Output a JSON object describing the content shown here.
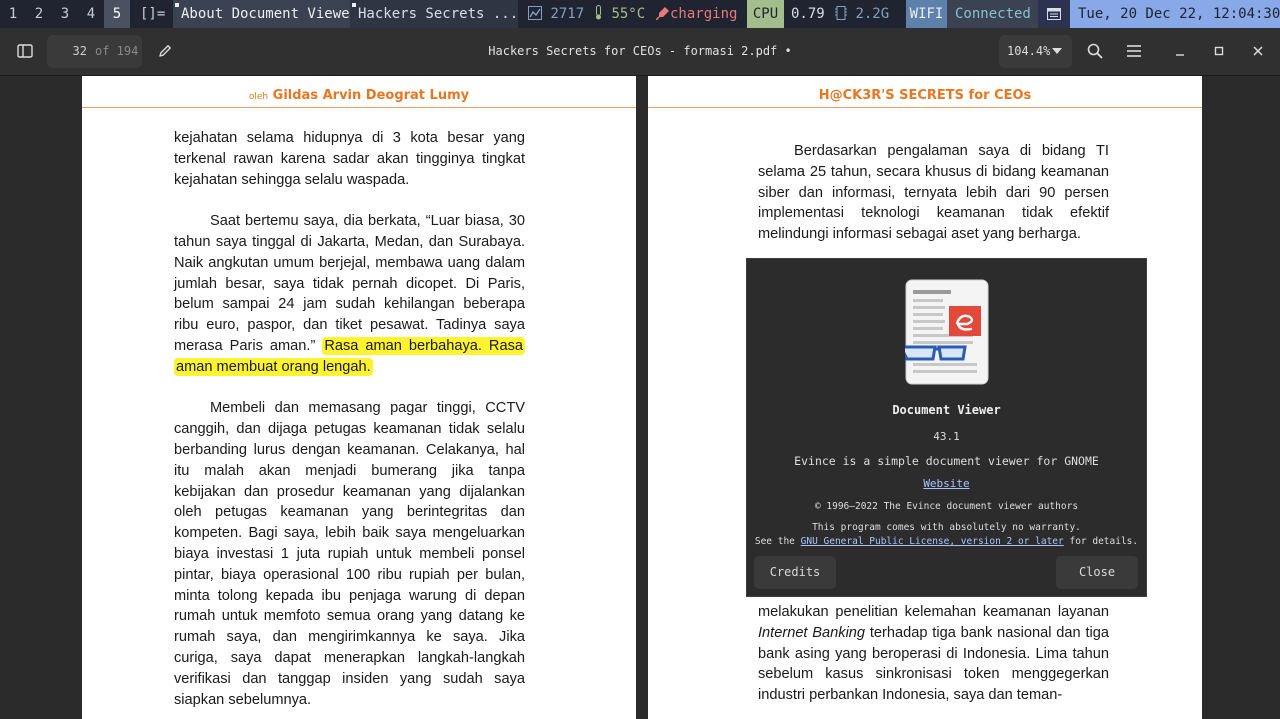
{
  "statusbar": {
    "workspaces": [
      "1",
      "2",
      "3",
      "4",
      "5"
    ],
    "active_workspace": "5",
    "layout": "[]=",
    "windows": [
      "About Document Viewer",
      "Hackers Secrets ..."
    ],
    "net": "2717",
    "temp": "55°C",
    "battery": "charging",
    "cpu_label": "CPU",
    "cpu_value": "0.79",
    "mem": "2.2G",
    "wifi_label": "WIFI",
    "wifi_value": "Connected",
    "datetime": "Tue, 20 Dec 22, 12:04:30AM"
  },
  "header": {
    "page_current": "32",
    "page_total": "of 194",
    "title": "Hackers Secrets for CEOs - formasi 2.pdf •",
    "zoom": "104.4%"
  },
  "left_page": {
    "header_by": "oleh",
    "header_author": "Gildas Arvin Deograt Lumy",
    "p1": "kejahatan selama hidupnya di 3 kota besar yang terkenal rawan karena sadar akan tingginya tingkat kejahatan sehingga selalu waspada.",
    "p2": "Saat bertemu saya, dia berkata, “Luar biasa, 30 tahun saya tinggal di Jakarta, Medan, dan Surabaya. Naik angkutan umum berjejal, membawa uang dalam jumlah besar, saya tidak pernah dicopet. Di Paris, belum sampai 24 jam sudah kehilangan beberapa ribu euro, paspor, dan tiket pesawat. Tadinya saya merasa Paris aman.”",
    "p2_highlight": "Rasa aman berbahaya. Rasa aman membuat orang lengah.",
    "p3": "Membeli dan memasang pagar tinggi, CCTV canggih, dan dijaga petugas keamanan tidak selalu berbanding lurus dengan keamanan. Celakanya, hal itu malah akan menjadi bumerang jika tanpa kebijakan dan prosedur keamanan yang dijalankan oleh petugas keamanan yang berintegritas dan kompeten. Bagi saya, lebih baik saya mengeluarkan biaya investasi 1 juta rupiah untuk membeli ponsel pintar, biaya operasional 100 ribu rupiah per bulan, minta tolong kepada ibu penjaga warung di depan rumah untuk memfoto semua orang yang datang ke rumah saya, dan mengirimkannya ke saya. Jika curiga, saya dapat menerapkan langkah-langkah verifikasi dan tanggap insiden yang sudah saya siapkan sebelumnya."
  },
  "right_page": {
    "header": "H@CK3R'S SECRETS for CEOs",
    "p1": "Berdasarkan pengalaman saya di bidang TI selama 25 tahun, secara khusus di bidang keamanan siber dan informasi, ternyata lebih dari 90 persen implementasi teknologi keamanan tidak efektif melindungi informasi sebagai aset yang berharga.",
    "p2_a": "melakukan penelitian kelemahan keamanan layanan",
    "p2_italic": "Internet Banking",
    "p2_b": "terhadap tiga bank nasional dan tiga bank asing yang beroperasi di Indonesia. Lima tahun sebelum kasus sinkronisasi token menggegerkan industri perbankan Indonesia, saya dan teman-"
  },
  "about": {
    "name": "Document Viewer",
    "version": "43.1",
    "comment": "Evince is a simple document viewer for GNOME",
    "website": "Website",
    "copyright": "© 1996–2022 The Evince document viewer authors",
    "warranty": "This program comes with absolutely no warranty.",
    "license_pre": "See the",
    "license_link": "GNU General Public License, version 2 or later",
    "license_post": "for details.",
    "credits": "Credits",
    "close": "Close"
  }
}
